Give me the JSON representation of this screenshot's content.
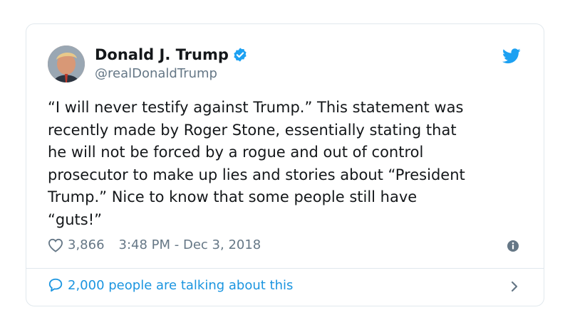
{
  "tweet": {
    "display_name": "Donald J. Trump",
    "handle": "@realDonaldTrump",
    "text": "“I will never testify against Trump.” This statement was\nrecently made by Roger Stone, essentially stating that\nhe will not be forced by a rogue and out of control\nprosecutor to make up lies and stories about “President\nTrump.” Nice to know that some people still have\n“guts!”",
    "likes": "3,866",
    "timestamp": "3:48 PM - Dec 3, 2018",
    "talking": "2,000 people are talking about this"
  },
  "icons": {
    "verified": "verified-badge-icon",
    "twitter": "twitter-bird-icon",
    "like": "heart-icon",
    "info": "info-icon",
    "reply": "speech-bubble-icon",
    "chevron": "chevron-right-icon"
  },
  "colors": {
    "brand_blue": "#1da1f2",
    "link_blue": "#1b95e0",
    "muted": "#657786",
    "border": "#e1e8ed"
  }
}
